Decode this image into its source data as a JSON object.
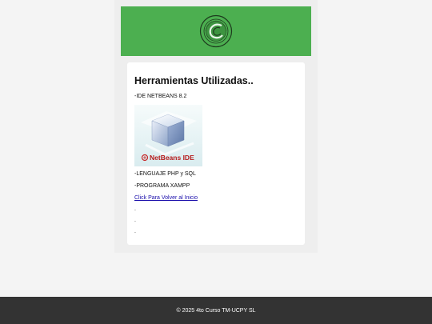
{
  "content": {
    "heading": "Herramientas Utilizadas..",
    "item_ide": "-IDE NETBEANS 8.2",
    "image_logo_text": "NetBeans IDE",
    "item_lang": "-LENGUAJE PHP y SQL",
    "item_xampp": "-PROGRAMA XAMPP",
    "back_link": "Click Para Volver al Inicio",
    "dot1": ".",
    "dot2": ".",
    "dot3": "."
  },
  "footer": {
    "text": "© 2025 4to Curso TM-UCPY SL"
  },
  "colors": {
    "banner": "#4caf50",
    "footer": "#333333",
    "link": "#1a0dab"
  },
  "icons": {
    "banner_logo": "circular-institution-seal",
    "netbeans": "netbeans-cube"
  }
}
